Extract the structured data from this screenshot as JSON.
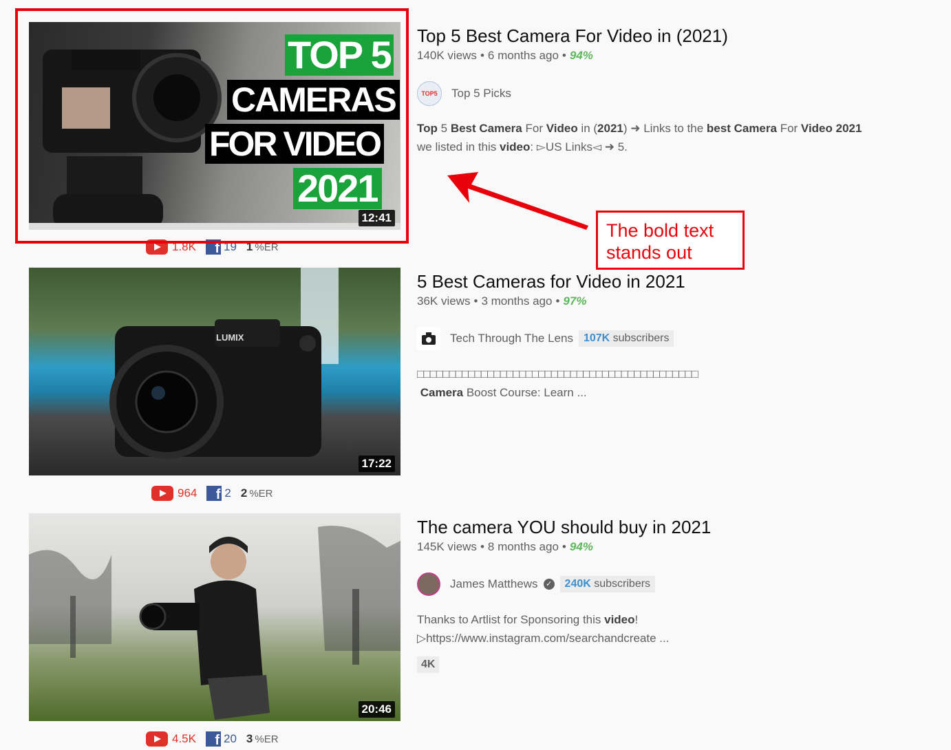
{
  "results": [
    {
      "title": "Top 5 Best Camera For Video in (2021)",
      "views": "140K views",
      "age": "6 months ago",
      "rating": "94%",
      "duration": "12:41",
      "thumbnail_text": [
        "TOP 5",
        "CAMERAS",
        "FOR VIDEO",
        "2021"
      ],
      "channel": "Top 5 Picks",
      "avatar_text": "TOP5",
      "desc_line1_parts": [
        "Top",
        " 5 ",
        "Best Camera",
        " For ",
        "Video",
        " in (",
        "2021",
        ") ➜ Links to the ",
        "best Camera",
        " For ",
        "Video 2021"
      ],
      "desc_line2_parts": [
        "we listed in this ",
        "video",
        ": ▻US Links◅ ➜ 5."
      ],
      "yt_count": "1.8K",
      "fb_count": "19",
      "er_value": "1",
      "er_label": "%ER"
    },
    {
      "title": "5 Best Cameras for Video in 2021",
      "views": "36K views",
      "age": "3 months ago",
      "rating": "97%",
      "duration": "17:22",
      "channel": "Tech Through The Lens",
      "subs_count": "107K",
      "subs_label": "subscribers",
      "desc_line1": "□□□□□□□□□□□□□□□□□□□□□□□□□□□□□□□□□□□□□□□□□□□□",
      "desc_line2_bold": "Camera",
      "desc_line2_rest": " Boost Course: Learn ...",
      "yt_count": "964",
      "fb_count": "2",
      "er_value": "2",
      "er_label": "%ER"
    },
    {
      "title": "The camera YOU should buy in 2021",
      "views": "145K views",
      "age": "8 months ago",
      "rating": "94%",
      "duration": "20:46",
      "channel": "James Matthews",
      "subs_count": "240K",
      "subs_label": "subscribers",
      "desc_line1_pre": "Thanks to Artlist for Sponsoring this ",
      "desc_line1_bold": "video",
      "desc_line1_post": "!",
      "desc_line2": "▷https://www.instagram.com/searchandcreate ...",
      "badge": "4K",
      "yt_count": "4.5K",
      "fb_count": "20",
      "er_value": "3",
      "er_label": "%ER"
    }
  ],
  "annotation": {
    "callout_text": "The bold text stands out",
    "color": "#e8000b"
  },
  "colors": {
    "background": "#f9f9f9",
    "rating_green": "#5cb85c",
    "subs_blue": "#3d8fcf",
    "youtube_red": "#e0302a",
    "facebook_blue": "#3b5998"
  },
  "icons": [
    "youtube-icon",
    "facebook-icon",
    "verified-icon"
  ]
}
